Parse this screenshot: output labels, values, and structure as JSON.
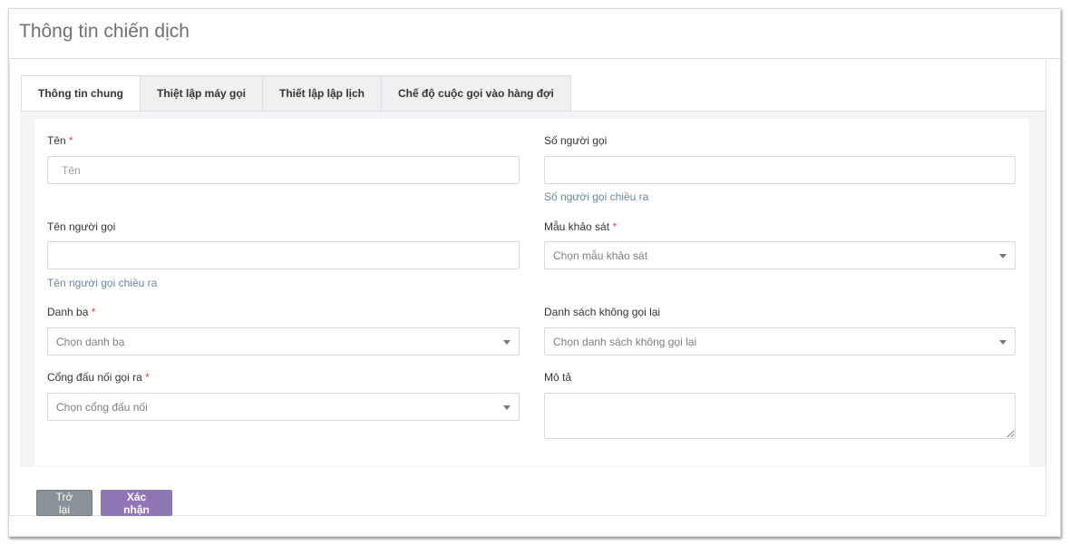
{
  "header": {
    "title": "Thông tin chiến dịch"
  },
  "tabs": [
    {
      "label": "Thông tin chung",
      "active": true
    },
    {
      "label": "Thiệt lập máy gọi",
      "active": false
    },
    {
      "label": "Thiết lập lập lịch",
      "active": false
    },
    {
      "label": "Chế độ cuộc gọi vào hàng đợi",
      "active": false
    }
  ],
  "form": {
    "name": {
      "label": "Tên",
      "required": "*",
      "placeholder": "Tên",
      "value": ""
    },
    "caller_number": {
      "label": "Số người gọi",
      "value": "",
      "help": "Số người gọi chiều ra"
    },
    "caller_name": {
      "label": "Tên người gọi",
      "value": "",
      "help": "Tên người gọi chiều ra"
    },
    "survey": {
      "label": "Mẫu khảo sát",
      "required": "*",
      "selected": "Chọn mẫu khảo sát"
    },
    "contacts": {
      "label": "Danh bạ",
      "required": "*",
      "selected": "Chọn danh bạ"
    },
    "dnc_list": {
      "label": "Danh sách không gọi lại",
      "selected": "Chọn danh sách không gọi lại"
    },
    "gateway": {
      "label": "Cổng đấu nối gọi ra",
      "required": "*",
      "selected": "Chọn cổng đấu nối"
    },
    "description": {
      "label": "Mô tả",
      "value": ""
    }
  },
  "actions": {
    "back_label": "Trở lại",
    "confirm_label": "Xác nhận"
  },
  "colors": {
    "accent": "#8f77b5",
    "required": "#e0454b",
    "help": "#6a8797"
  }
}
